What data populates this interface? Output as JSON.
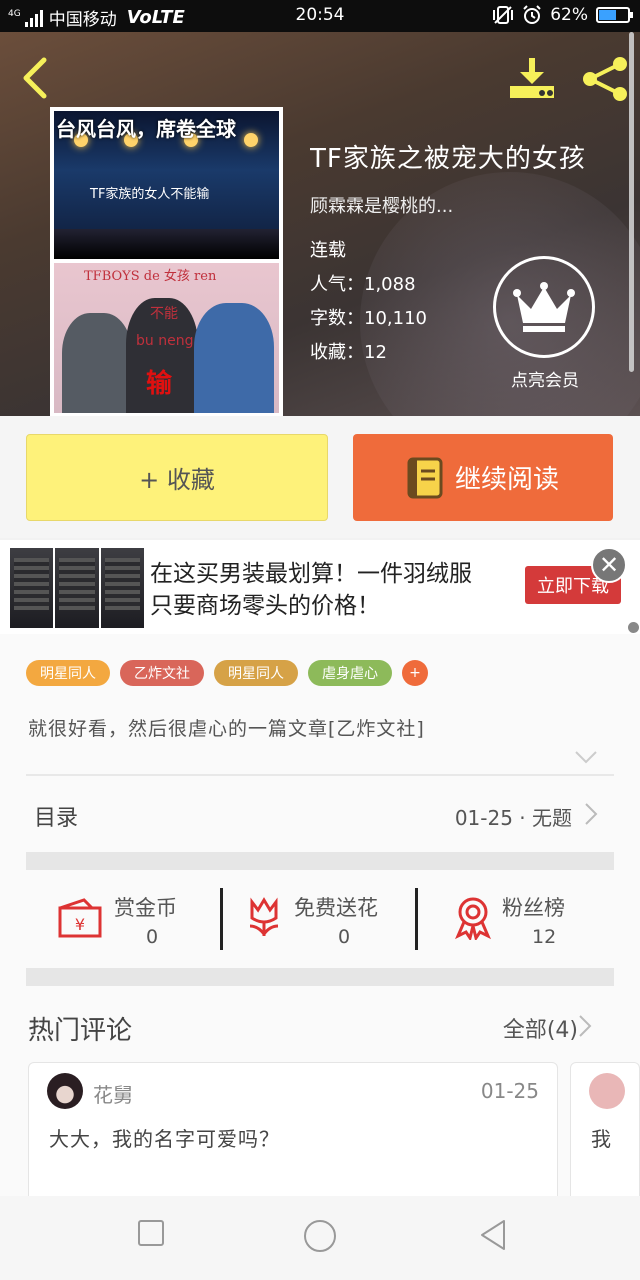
{
  "status_bar": {
    "carrier": "中国移动",
    "network": "VoLTE",
    "signal_label": "4G",
    "time": "20:54",
    "battery_percent": "62%",
    "battery_level": 0.62
  },
  "book": {
    "title": "TF家族之被宠大的女孩",
    "author": "顾霖霖是樱桃的...",
    "status": "连载",
    "popularity": "人气：1,088",
    "word_count": "字数：10,110",
    "favorites": "收藏：12",
    "cover": {
      "top_text": "台风台风，席卷全球",
      "top_caption": "TF家族的女人不能输",
      "bottom_line1": "TFBOYS de 女孩 ren",
      "bottom_line2": "不能",
      "bottom_line3": "bu neng",
      "bottom_line4": "输"
    },
    "member_label": "点亮会员"
  },
  "actions": {
    "collect_label": "+ 收藏",
    "read_label": "继续阅读"
  },
  "ad": {
    "line1": "在这买男装最划算！一件羽绒服",
    "line2": "只要商场零头的价格！",
    "cta": "立即下载"
  },
  "tags": [
    {
      "label": "明星同人",
      "color": "#f3a840"
    },
    {
      "label": "乙炸文社",
      "color": "#d9665a"
    },
    {
      "label": "明星同人",
      "color": "#d6a247"
    },
    {
      "label": "虐身虐心",
      "color": "#8dba5a"
    }
  ],
  "tag_add": "+",
  "intro": "就很好看，然后很虐心的一篇文章[乙炸文社]",
  "toc": {
    "label": "目录",
    "latest": "01-25 · 无题"
  },
  "stats": [
    {
      "name": "赏金币",
      "value": "0",
      "icon": "red-envelope-icon"
    },
    {
      "name": "免费送花",
      "value": "0",
      "icon": "flower-icon"
    },
    {
      "name": "粉丝榜",
      "value": "12",
      "icon": "medal-icon"
    }
  ],
  "comments": {
    "title": "热门评论",
    "all_label": "全部(4)",
    "items": [
      {
        "user": "花舅",
        "date": "01-25",
        "text": "大大，我的名字可爱吗？"
      },
      {
        "text": "我"
      }
    ]
  },
  "colors": {
    "accent_orange": "#ef6b3b",
    "collect_yellow": "#fef27a",
    "ad_red": "#d43a3a"
  }
}
